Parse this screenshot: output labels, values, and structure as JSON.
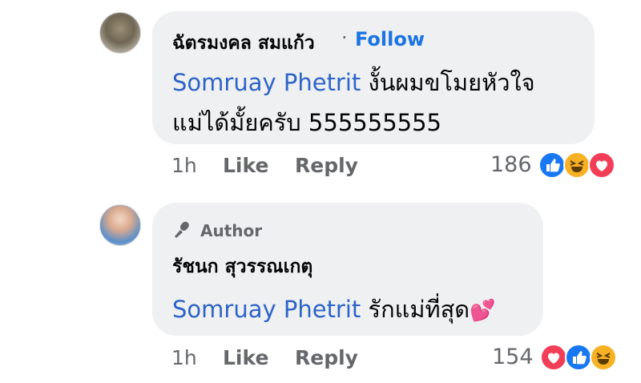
{
  "comments": [
    {
      "name": "ฉัตรมงคล สมแก้ว",
      "follow_label": "Follow",
      "separator": "·",
      "mention": "Somruay Phetrit",
      "text_line1": "งั้นผมขโมยหัวใจ",
      "text_line2": "แม่ได้มั้ยครับ 555555555",
      "time": "1h",
      "like_label": "Like",
      "reply_label": "Reply",
      "reaction_count": "186",
      "reactions": [
        "like-icon",
        "haha-icon",
        "love-icon"
      ]
    },
    {
      "badge": "Author",
      "name": "รัชนก สุวรรณเกตุ",
      "mention": "Somruay Phetrit",
      "text": "รักแม่ที่สุด",
      "emoji": "💕",
      "time": "1h",
      "like_label": "Like",
      "reply_label": "Reply",
      "reaction_count": "154",
      "reactions": [
        "love-icon",
        "like-icon",
        "haha-icon"
      ]
    }
  ],
  "colors": {
    "bubble": "#eff0f2",
    "link": "#1b74e4",
    "mention": "#2d64c8",
    "meta": "#65676b"
  }
}
